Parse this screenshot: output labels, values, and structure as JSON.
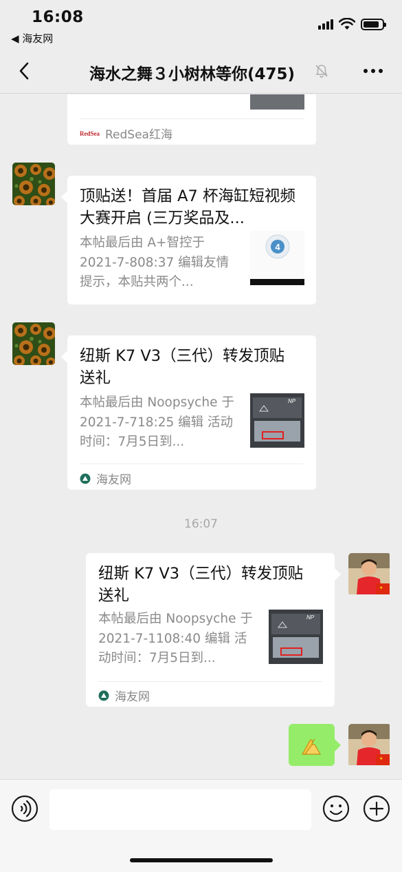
{
  "status_bar": {
    "time": "16:08",
    "back_app": "◀ 海友网"
  },
  "nav": {
    "title": "海水之舞３小树林等你(475)",
    "icons": [
      "chevron-left-icon",
      "bell-mute-icon",
      "more-icon"
    ]
  },
  "messages": [
    {
      "type": "link_card_partial",
      "source": "RedSea红海"
    },
    {
      "type": "link_card",
      "sender": "other",
      "title": "顶贴送！首届 A7 杯海缸短视频大赛开启 (三万奖品及...",
      "desc": "本帖最后由 A+智控于 2021-7-808:37 编辑友情提示，本贴共两个..."
    },
    {
      "type": "link_card",
      "sender": "other",
      "title": "纽斯 K7 V3（三代）转发顶贴送礼",
      "desc": "本帖最后由 Noopsyche 于 2021-7-718:25 编辑 活动时间：7月5日到...",
      "source": "海友网"
    },
    {
      "type": "timestamp",
      "text": "16:07"
    },
    {
      "type": "link_card",
      "sender": "self",
      "title": "纽斯 K7 V3（三代）转发顶贴送礼",
      "desc": "本帖最后由 Noopsyche 于 2021-7-1108:40 编辑 活动时间：7月5日到...",
      "source": "海友网"
    },
    {
      "type": "sticker",
      "sender": "self",
      "icon": "hands-icon"
    }
  ],
  "input": {
    "placeholder": "",
    "icons": [
      "voice-icon",
      "emoji-icon",
      "plus-icon"
    ]
  },
  "colors": {
    "background": "#ededed",
    "self_bubble": "#95ec69",
    "card_bg": "#ffffff",
    "muted_text": "#8a8a8a"
  }
}
